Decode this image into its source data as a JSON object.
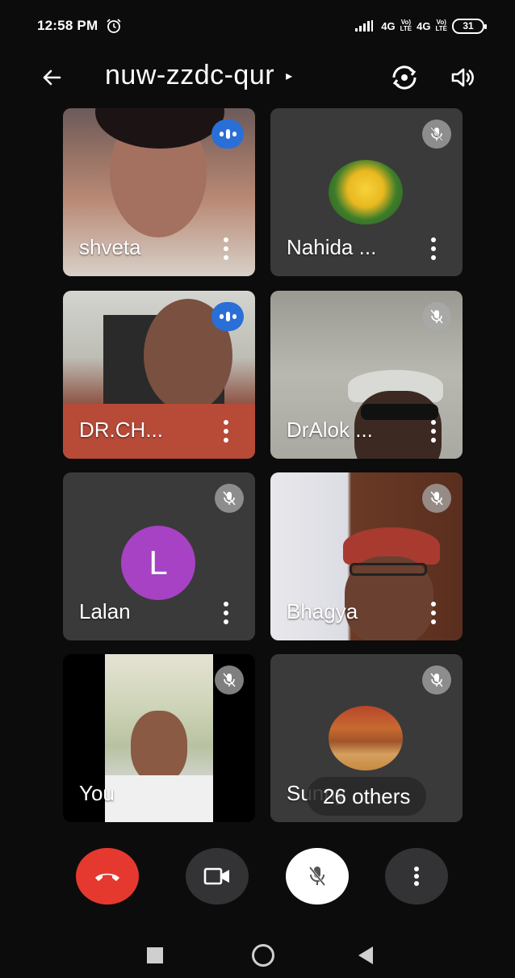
{
  "status_bar": {
    "time": "12:58 PM",
    "network1": "4G",
    "volte1_top": "Vo)",
    "volte1_bottom": "LTE",
    "network2": "4G",
    "volte2_top": "Vo)",
    "volte2_bottom": "LTE",
    "battery": "31"
  },
  "header": {
    "meeting_code": "nuw-zzdc-qur",
    "caret": "▸"
  },
  "participants": [
    {
      "name": "shveta",
      "state": "speaking",
      "bg": "video"
    },
    {
      "name": "Nahida ...",
      "state": "muted",
      "bg": "photo-avatar"
    },
    {
      "name": "DR.CH...",
      "state": "speaking",
      "bg": "video"
    },
    {
      "name": "DrAlok ...",
      "state": "muted",
      "bg": "video"
    },
    {
      "name": "Lalan",
      "state": "muted",
      "bg": "letter-avatar",
      "initial": "L"
    },
    {
      "name": "Bhagya",
      "state": "muted",
      "bg": "video"
    },
    {
      "name": "You",
      "state": "muted",
      "bg": "video"
    },
    {
      "name": "Sunny",
      "state": "muted",
      "bg": "photo-avatar"
    }
  ],
  "others_pill": "26 others",
  "colors": {
    "speaking_badge": "#2a6fd6",
    "hangup": "#e5392f",
    "letter_avatar": "#a742c4",
    "tile_bg": "#3a3a3a"
  }
}
